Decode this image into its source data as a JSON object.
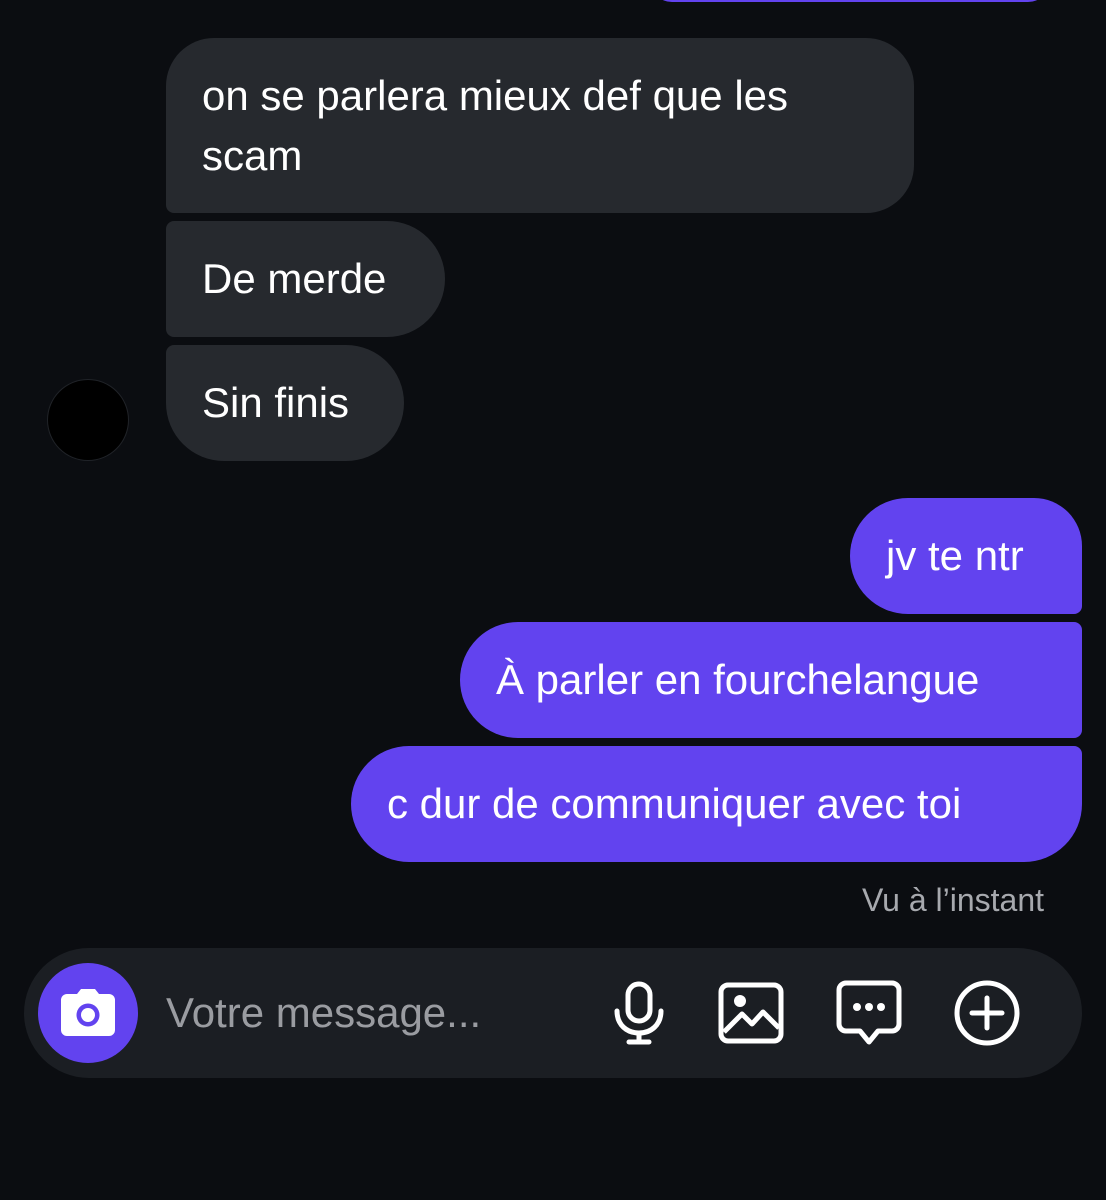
{
  "conversation": {
    "messages": [
      {
        "direction": "received",
        "text": "on se parlera mieux def que les scam"
      },
      {
        "direction": "received",
        "text": "De merde"
      },
      {
        "direction": "received",
        "text": "Sin finis"
      },
      {
        "direction": "sent",
        "text": "jv te ntr"
      },
      {
        "direction": "sent",
        "text": "À parler en fourchelangue"
      },
      {
        "direction": "sent",
        "text": "c dur de communiquer avec toi"
      }
    ],
    "seen_status": "Vu à l’instant"
  },
  "composer": {
    "placeholder": "Votre message...",
    "icons": {
      "camera": "camera-icon",
      "microphone": "microphone-icon",
      "gallery": "gallery-icon",
      "sticker": "sticker-icon",
      "plus": "plus-circle-icon"
    }
  },
  "colors": {
    "background": "#0b0d11",
    "received_bubble": "#26292e",
    "sent_bubble": "#6243ef",
    "composer_background": "#1b1e23",
    "accent": "#6243ef",
    "muted_text": "#a7a9ae"
  }
}
